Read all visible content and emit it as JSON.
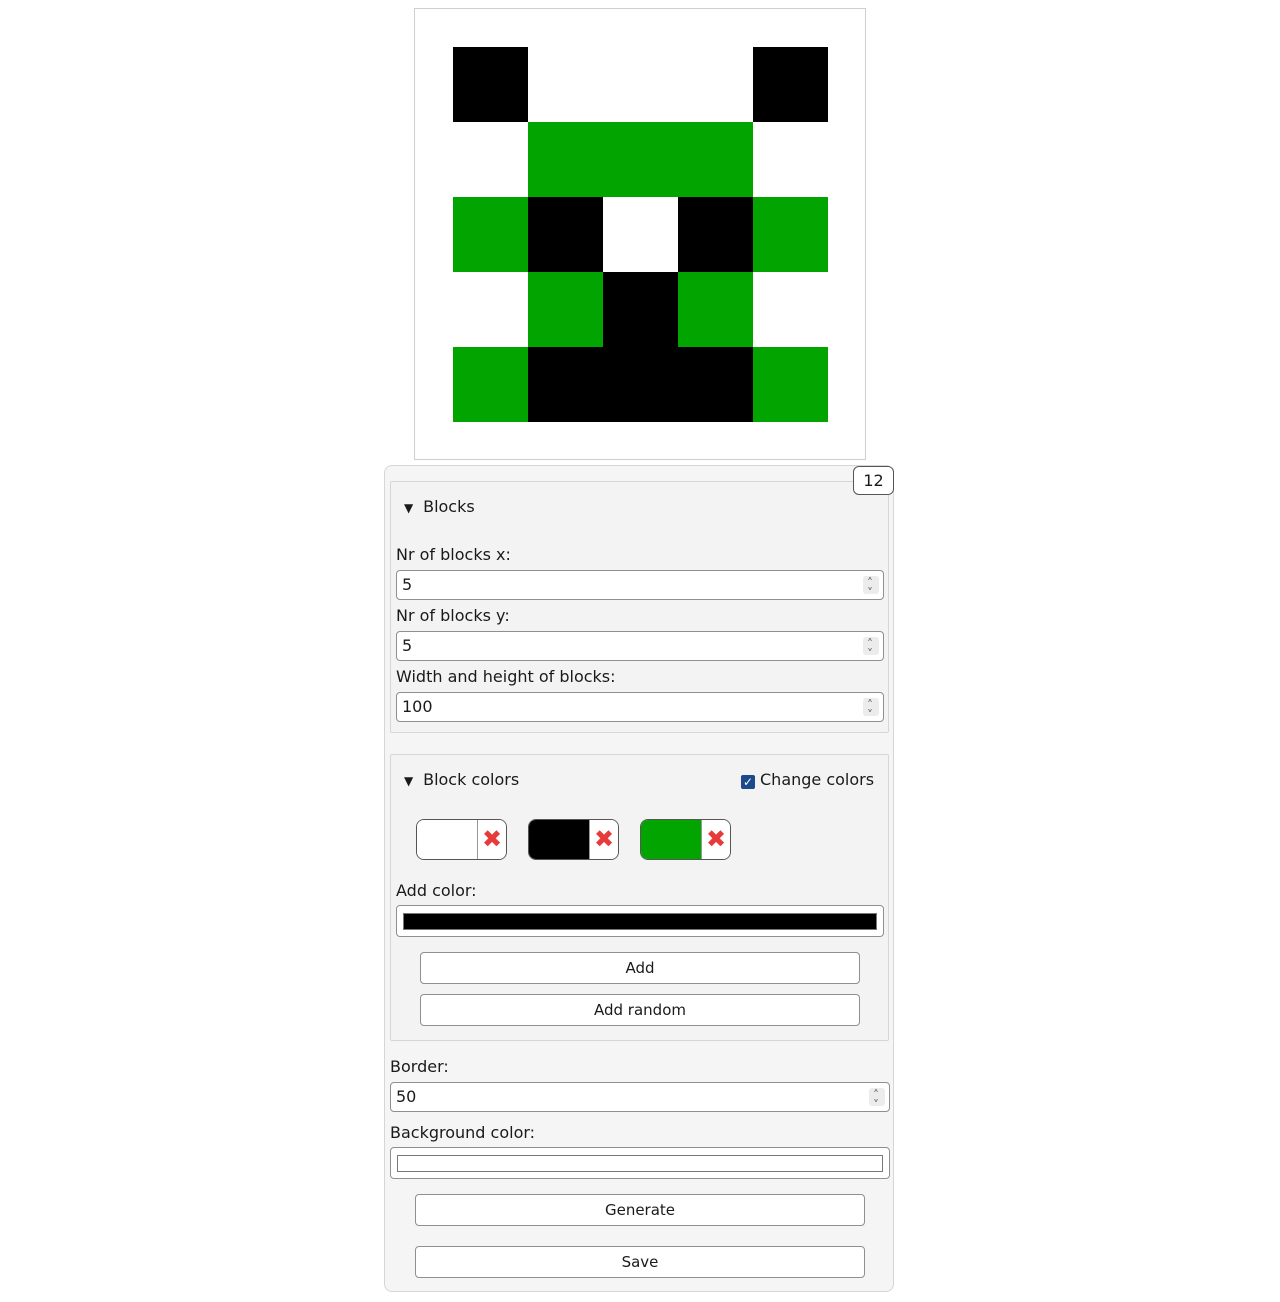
{
  "preview": {
    "background": "#ffffff",
    "palette": {
      "W": "#ffffff",
      "B": "#000000",
      "G": "#02a400"
    },
    "grid": [
      [
        "B",
        "W",
        "W",
        "W",
        "B"
      ],
      [
        "W",
        "G",
        "G",
        "G",
        "W"
      ],
      [
        "G",
        "B",
        "W",
        "B",
        "G"
      ],
      [
        "W",
        "G",
        "B",
        "G",
        "W"
      ],
      [
        "G",
        "B",
        "B",
        "B",
        "G"
      ]
    ]
  },
  "counter": "12",
  "blocks": {
    "summary": "Blocks",
    "nx_label": "Nr of blocks x:",
    "nx_value": "5",
    "ny_label": "Nr of blocks y:",
    "ny_value": "5",
    "size_label": "Width and height of blocks:",
    "size_value": "100"
  },
  "block_colors": {
    "summary": "Block colors",
    "change_colors_label": "Change colors",
    "change_colors_checked": true,
    "swatches": [
      "#ffffff",
      "#000000",
      "#02a400"
    ],
    "remove_icon": "✖",
    "add_color_label": "Add color:",
    "add_color_value": "#000000",
    "add_button": "Add",
    "add_random_button": "Add random"
  },
  "border": {
    "label": "Border:",
    "value": "50"
  },
  "background": {
    "label": "Background color:",
    "value": "#ffffff"
  },
  "generate_button": "Generate",
  "save_button": "Save"
}
